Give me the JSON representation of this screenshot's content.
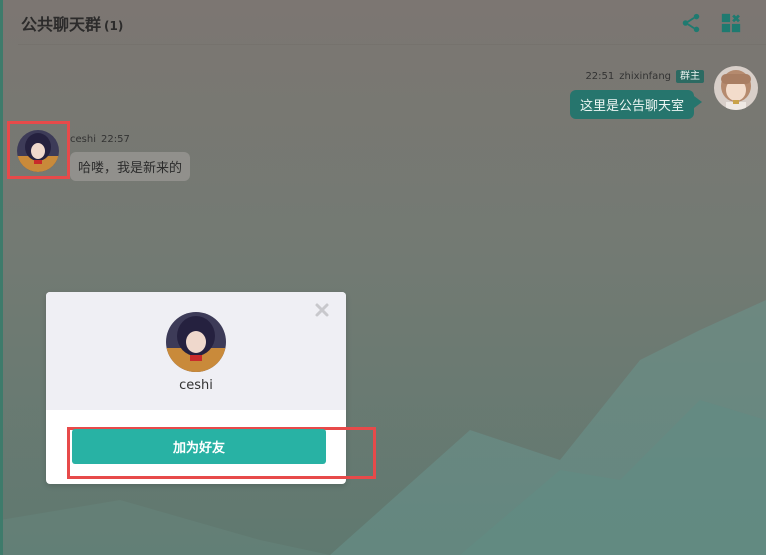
{
  "header": {
    "title": "公共聊天群",
    "member_count": "(1)",
    "share_icon": "share-icon",
    "grid_icon": "grid-add-icon"
  },
  "messages": [
    {
      "side": "right",
      "time": "22:51",
      "user": "zhixinfang",
      "badge": "群主",
      "text": "这里是公告聊天室"
    },
    {
      "side": "left",
      "user": "ceshi",
      "time": "22:57",
      "text": "哈喽，我是新来的"
    }
  ],
  "popup": {
    "name": "ceshi",
    "add_friend_label": "加为好友",
    "close_icon": "close-icon"
  },
  "colors": {
    "accent": "#28b2a4",
    "bubble_self": "#26756d",
    "highlight": "#e74a4a"
  }
}
